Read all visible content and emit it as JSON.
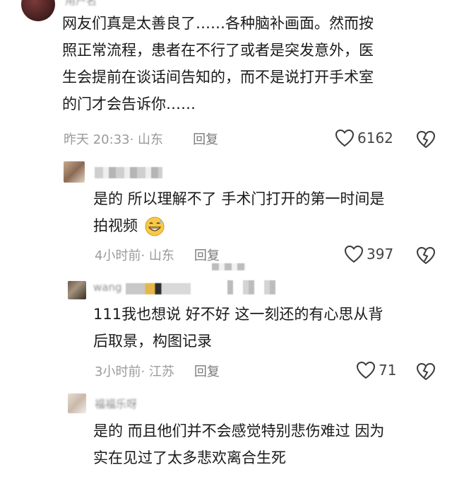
{
  "comments": [
    {
      "username": "用户名",
      "lines": [
        "网友们真是太善良了……各种脑补画面。然而按",
        "照正常流程，患者在不行了或者是突发意外，医",
        "生会提前在谈话间告知的，而不是说打开手术室",
        "的门才会告诉你……"
      ],
      "time": "昨天 20:33",
      "location": "· 山东",
      "reply_label": "回复",
      "likes": "6162"
    },
    {
      "username": "",
      "lines": [
        "是的 所以理解不了 手术门打开的第一时间是",
        "拍视频"
      ],
      "emoji": "grin-sweat-emoji",
      "time": "4小时前",
      "location": "· 山东",
      "reply_label": "回复",
      "likes": "397"
    },
    {
      "username": "wang",
      "lines": [
        "111我也想说 好不好 这一刻还的有心思从背",
        "后取景，构图记录"
      ],
      "time": "3小时前",
      "location": "· 江苏",
      "reply_label": "回复",
      "likes": "71"
    },
    {
      "username": "福福乐呀",
      "lines": [
        "是的 而且他们并不会感觉特别悲伤难过 因为",
        "实在见过了太多悲欢离合生死"
      ]
    }
  ],
  "colors": {
    "text": "#1a1a1a",
    "meta": "#9a9a9a",
    "icon": "#3a3a3a"
  }
}
